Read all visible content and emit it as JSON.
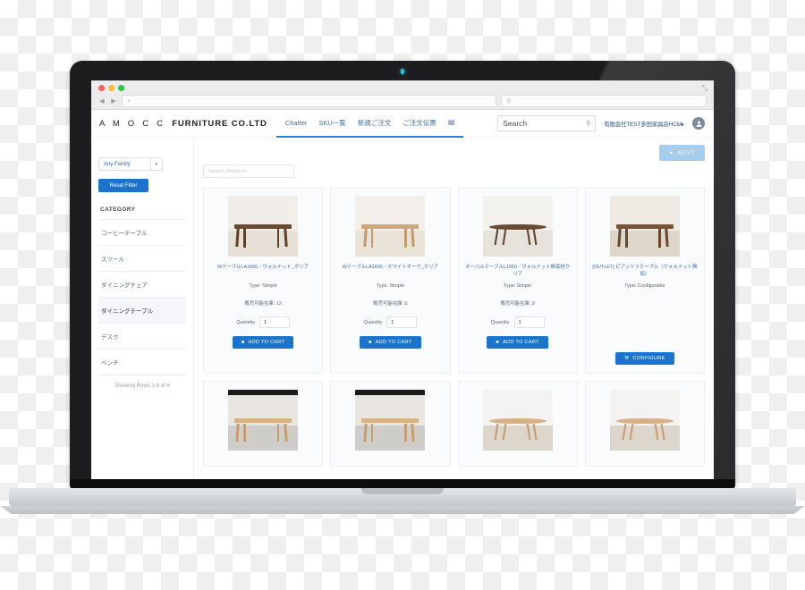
{
  "browser": {
    "url_value": "",
    "url_placeholder": "",
    "search_placeholder": "",
    "back_icon": "◀",
    "forward_icon": "▶",
    "new_tab_icon": "+",
    "search_icon": "⚲",
    "expand_icon": "⤡"
  },
  "header": {
    "brand_prefix": "A M O C C",
    "brand_name": "FURNITURE CO.LTD",
    "nav": [
      {
        "label": "Chatter"
      },
      {
        "label": "SKU一覧"
      },
      {
        "label": "新規ご注文"
      },
      {
        "label": "ご注文伝票"
      }
    ],
    "nav_more_icon": "▤",
    "search_text": "Search",
    "search_icon": "⚲",
    "org_name": "有限会社TEST多田家具店HCM",
    "org_caret": "▸",
    "avatar_icon": "user-avatar"
  },
  "action_bar": {
    "next_label": "NEXT",
    "next_icon": "✦"
  },
  "sidebar": {
    "family_select": "Any Family",
    "family_caret": "▾",
    "reset_filter": "Reset Filter",
    "category_header": "CATEGORY",
    "categories": [
      {
        "label": "コーヒーテーブル",
        "active": false
      },
      {
        "label": "スツール",
        "active": false
      },
      {
        "label": "ダイニングチェア",
        "active": false
      },
      {
        "label": "ダイニングテーブル",
        "active": true
      },
      {
        "label": "デスク",
        "active": false
      },
      {
        "label": "ベンチ",
        "active": false
      }
    ],
    "showing_rows": "Showing Rows 1-6 of 6"
  },
  "catalog": {
    "search_placeholder": "Search Products",
    "quantity_label": "Quantity",
    "add_to_cart_label": "ADD TO CART",
    "add_to_cart_icon": "Ὥ2",
    "configure_label": "CONFIGURE",
    "configure_icon": "⚒",
    "products": [
      {
        "title": "WテーブルLA1600／ウォルナット_クリア",
        "type": "Type: Simple",
        "stock": "販売可能在庫: 12",
        "quantity": "1",
        "action": "cart",
        "image": "walnut-rect-table"
      },
      {
        "title": "WテーブルLA1600／ホワイトオーク_クリア",
        "type": "Type: Simple",
        "stock": "販売可能在庫: 6",
        "quantity": "1",
        "action": "cart",
        "image": "oak-rect-table"
      },
      {
        "title": "オーバルテーブルL1650／ウォルナット無垢材クリア",
        "type": "Type: Simple",
        "stock": "販売可能在庫: 9",
        "quantity": "1",
        "action": "cart",
        "image": "oval-walnut-table"
      },
      {
        "title": "[OUTLET] ピアッツァテーブル（ウォルナット無垢）",
        "type": "Type: Configurable",
        "stock": "",
        "quantity": "",
        "action": "configure",
        "image": "outlet-walnut-table"
      },
      {
        "title": "",
        "type": "",
        "stock": "",
        "quantity": "",
        "action": "none",
        "image": "oak-dining-table-room"
      },
      {
        "title": "",
        "type": "",
        "stock": "",
        "quantity": "",
        "action": "none",
        "image": "oak-dining-table-room"
      },
      {
        "title": "",
        "type": "",
        "stock": "",
        "quantity": "",
        "action": "none",
        "image": "oak-oval-table-white"
      },
      {
        "title": "",
        "type": "",
        "stock": "",
        "quantity": "",
        "action": "none",
        "image": "oak-oval-table-white"
      }
    ]
  },
  "colors": {
    "accent_blue": "#1a73cc",
    "nav_underline": "#2a7fd4",
    "next_button": "#a5cdf0",
    "link_blue": "#3a6bb0"
  }
}
